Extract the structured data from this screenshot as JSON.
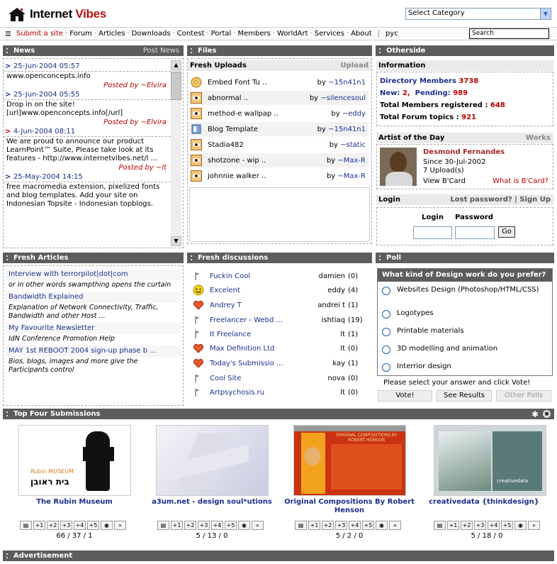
{
  "site": {
    "name_part1": "Internet",
    "name_part2": "Vibes"
  },
  "category_select": {
    "selected": "Select Category"
  },
  "menu": [
    "Submit a site",
    "Forum",
    "Articles",
    "Downloads",
    "Contest",
    "Portal",
    "Members",
    "WorldArt",
    "Services",
    "About",
    "pyc"
  ],
  "search_label": "Search",
  "news": {
    "title": "News",
    "action": "Post News",
    "items": [
      {
        "date": "25-Jun-2004 05:57",
        "text": "www.openconcepts.info",
        "posted": "Posted by ",
        "author": "~Elvira"
      },
      {
        "date": "25-Jun-2004 05:55",
        "text": "Drop in on the site! [url]www.openconcepts.info[/url]",
        "posted": "Posted by ",
        "author": "~Elvira"
      },
      {
        "date": "4-Jun-2004 08:11",
        "text": "We are proud to announce our product LearnPoint™ Suite, Please take look at its features - http://www.internetvibes.net/l ...",
        "posted": "Posted by ",
        "author": "~lt"
      },
      {
        "date": "25-May-2004 14:15",
        "text": "free macromedia extension, pixelized fonts and blog templates. Add your site on Indonesian Topsite - Indonesian topblogs.",
        "posted": "",
        "author": ""
      }
    ]
  },
  "files": {
    "title": "Files",
    "sub": "Fresh Uploads",
    "action": "Upload",
    "items": [
      {
        "name": "Embed Font Tu ..",
        "by": "by ",
        "author": "~15n41n1"
      },
      {
        "name": "abnormal ..",
        "by": "by ",
        "author": "~silencesoul"
      },
      {
        "name": "method-e wallpap ..",
        "by": "by ",
        "author": "~eddy"
      },
      {
        "name": "Blog Template",
        "by": "by ",
        "author": "~15n41n1"
      },
      {
        "name": "Stadia482",
        "by": "by ",
        "author": "~static"
      },
      {
        "name": "shotzone - wip ..",
        "by": "by ",
        "author": "~Max-R"
      },
      {
        "name": "johnnie walker ..",
        "by": "by ",
        "author": "~Max-R"
      }
    ]
  },
  "otherside": {
    "title": "Otherside",
    "info_title": "Information",
    "dir_label": "Directory Members",
    "dir_value": "3738",
    "new_label": "New:",
    "new_value": "2,",
    "pending_label": "Pending:",
    "pending_value": "989",
    "total_label": "Total Members registered :",
    "total_value": "648",
    "forum_label": "Total Forum topics :",
    "forum_value": "921"
  },
  "artist": {
    "title": "Artist of the Day",
    "action": "Works",
    "name": "Desmond Fernandes",
    "since": "Since 30-Jul-2002",
    "uploads": "7 Upload(s)",
    "view": "View B'Card",
    "what": "What is B'Card?"
  },
  "login": {
    "title": "Login",
    "lost": "Lost password?",
    "sep": " | ",
    "signup": "Sign Up",
    "login_label": "Login",
    "password_label": "Password",
    "go": "Go"
  },
  "articles": {
    "title": "Fresh Articles",
    "items": [
      {
        "title": "Interview with terrorpilot|dot|com",
        "desc": "or in other words swampthing opens the curtain"
      },
      {
        "title": "Bandwidth Explained",
        "desc": "Explanation of Network Connectivity, Traffic, Bandwidth and other Host ..."
      },
      {
        "title": "My Favourite Newsletter",
        "desc": "IdN Conference Promotion Help"
      },
      {
        "title": "MAY 1st REBOOT 2004 sign-up phase b ...",
        "desc": "Bios, blogs, images and more give the Participants control"
      }
    ]
  },
  "discussions": {
    "title": "Fresh discussions",
    "items": [
      {
        "topic": "Fuckin Cool",
        "author": "damien",
        "count": "(0)",
        "icon": "flag-icon"
      },
      {
        "topic": "Excelent",
        "author": "eddy",
        "count": "(4)",
        "icon": "smiley-icon"
      },
      {
        "topic": "Andrey T",
        "author": "andrei t",
        "count": "(1)",
        "icon": "heart-icon"
      },
      {
        "topic": "Freelancer - Webd ...",
        "author": "ishtiaq",
        "count": "(19)",
        "icon": "flag-icon"
      },
      {
        "topic": "It Freelance",
        "author": "lt",
        "count": "(1)",
        "icon": "flag-icon"
      },
      {
        "topic": "Max Definition Ltd",
        "author": "lt",
        "count": "(0)",
        "icon": "heart-icon"
      },
      {
        "topic": "Today's Submissio ...",
        "author": "kay",
        "count": "(1)",
        "icon": "heart-icon"
      },
      {
        "topic": "Cool Site",
        "author": "nova",
        "count": "(0)",
        "icon": "flag-icon"
      },
      {
        "topic": "Artpsychosis.ru",
        "author": "lt",
        "count": "(0)",
        "icon": "flag-icon"
      }
    ]
  },
  "poll": {
    "title": "Poll",
    "question": "What kind of Design work do you prefer?",
    "options": [
      "Websites Design (Photoshop/HTML/CSS)",
      "Logotypes",
      "Printable materials",
      "3D modelling and animation",
      "Interrior design"
    ],
    "note": "Please select your answer and click Vote!",
    "vote": "Vote!",
    "results": "See Results",
    "other": "Other Polls"
  },
  "top": {
    "title": "Top Four Submissions",
    "items": [
      {
        "caption": "The Rubin Museum",
        "stats": "66 / 37 / 1",
        "thumb_text1": "Rubin MUSEUM",
        "thumb_text2": "בית ראובן"
      },
      {
        "caption": "a3um.net - design soul*utions",
        "stats": "5 / 13 / 0"
      },
      {
        "caption": "Original Compositions By Robert Henson",
        "stats": "5 / 2 / 0",
        "thumb_text1": "ORIGINAL COMPOSITIONS BY ROBERT HENSON"
      },
      {
        "caption": "creativedata {thinkdesign}",
        "stats": "5 / 18 / 0",
        "thumb_text1": "creativedata"
      }
    ],
    "rate_labels": [
      "",
      "+1",
      "+2",
      "+3",
      "+4",
      "+5",
      "",
      "»"
    ]
  },
  "ad": {
    "title": "Advertisement"
  }
}
